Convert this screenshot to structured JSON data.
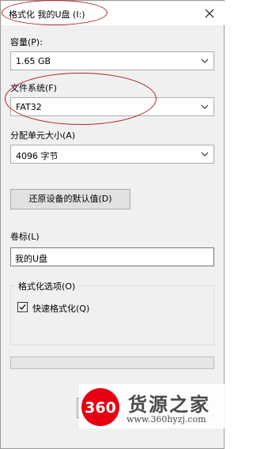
{
  "window": {
    "title": "格式化 我的U盘 (I:)",
    "close_icon": "close-icon"
  },
  "capacity": {
    "label": "容量(P):",
    "value": "1.65 GB"
  },
  "file_system": {
    "label": "文件系统(F)",
    "value": "FAT32"
  },
  "allocation": {
    "label": "分配单元大小(A)",
    "value": "4096 字节"
  },
  "restore_defaults_label": "还原设备的默认值(D)",
  "volume_label": {
    "label": "卷标(L)",
    "value": "我的U盘"
  },
  "format_options": {
    "legend": "格式化选项(O)",
    "quick_format_label": "快速格式化(Q)",
    "quick_format_checked": true
  },
  "progress": {
    "percent": 0
  },
  "annotation_color": "#b42424",
  "watermark": {
    "logo_text": "360",
    "name": "货源之家",
    "url": "www.360hyzj.com",
    "colors": {
      "red": "#e60012",
      "dark": "#4a4a4a"
    }
  }
}
